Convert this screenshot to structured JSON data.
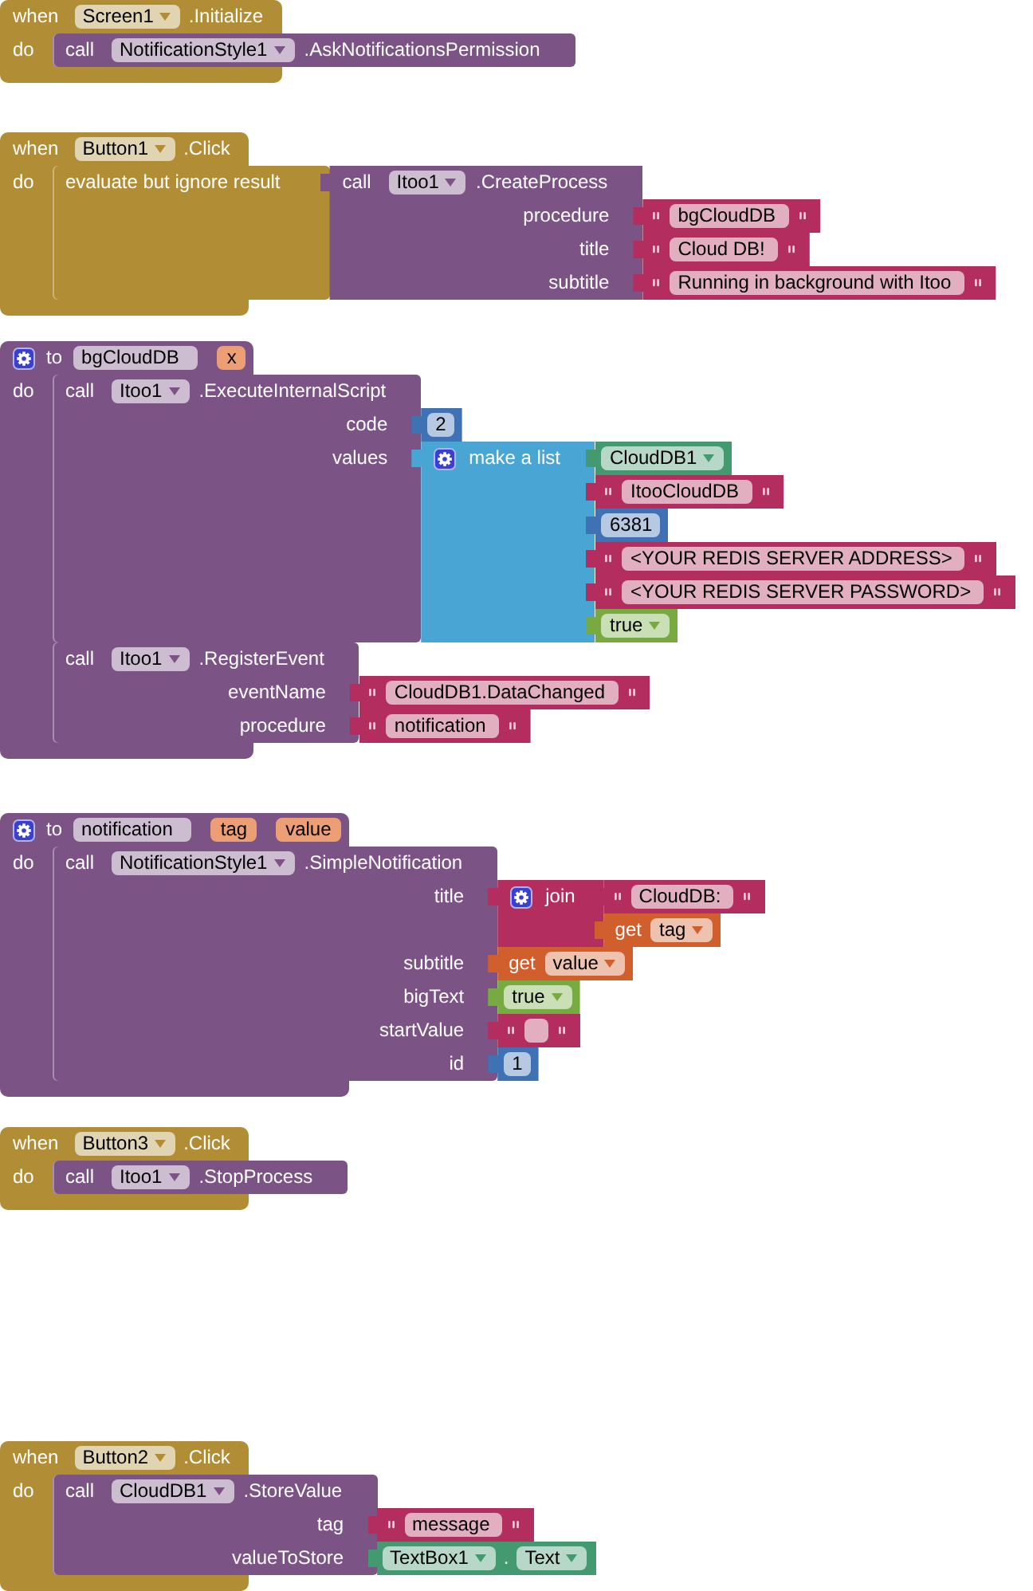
{
  "blocks": [
    {
      "kind": "event",
      "keyword": "when",
      "component": "Screen1",
      "event": ".Initialize",
      "do_label": "do",
      "body": [
        {
          "kind": "call",
          "keyword": "call",
          "component": "NotificationStyle1",
          "method": ".AskNotificationsPermission"
        }
      ]
    },
    {
      "kind": "event",
      "keyword": "when",
      "component": "Button1",
      "event": ".Click",
      "do_label": "do",
      "body": [
        {
          "kind": "evaluate",
          "text": "evaluate but ignore result",
          "inputs": [
            {
              "value": {
                "kind": "call",
                "keyword": "call",
                "component": "Itoo1",
                "method": ".CreateProcess",
                "inputs": [
                  {
                    "label": "procedure",
                    "value": {
                      "kind": "text",
                      "text": "bgCloudDB"
                    }
                  },
                  {
                    "label": "title",
                    "value": {
                      "kind": "text",
                      "text": "Cloud DB!"
                    }
                  },
                  {
                    "label": "subtitle",
                    "value": {
                      "kind": "text",
                      "text": "Running in background with Itoo"
                    }
                  }
                ]
              }
            }
          ]
        }
      ]
    },
    {
      "kind": "procedure",
      "keyword": "to",
      "name": "bgCloudDB",
      "params": [
        "x"
      ],
      "do_label": "do",
      "body": [
        {
          "kind": "call",
          "keyword": "call",
          "component": "Itoo1",
          "method": ".ExecuteInternalScript",
          "inputs": [
            {
              "label": "code",
              "value": {
                "kind": "number",
                "text": "2"
              }
            },
            {
              "label": "values",
              "value": {
                "kind": "make_list",
                "text": "make a list",
                "inputs": [
                  {
                    "value": {
                      "kind": "component",
                      "component": "CloudDB1"
                    }
                  },
                  {
                    "value": {
                      "kind": "text",
                      "text": "ItooCloudDB"
                    }
                  },
                  {
                    "value": {
                      "kind": "number",
                      "text": "6381"
                    }
                  },
                  {
                    "value": {
                      "kind": "text",
                      "text": "<YOUR REDIS SERVER ADDRESS>"
                    }
                  },
                  {
                    "value": {
                      "kind": "text",
                      "text": "<YOUR REDIS SERVER PASSWORD>"
                    }
                  },
                  {
                    "value": {
                      "kind": "boolean",
                      "text": "true"
                    }
                  }
                ]
              }
            }
          ]
        },
        {
          "kind": "call",
          "keyword": "call",
          "component": "Itoo1",
          "method": ".RegisterEvent",
          "inputs": [
            {
              "label": "eventName",
              "value": {
                "kind": "text",
                "text": "CloudDB1.DataChanged"
              }
            },
            {
              "label": "procedure",
              "value": {
                "kind": "text",
                "text": "notification"
              }
            }
          ]
        }
      ]
    },
    {
      "kind": "procedure",
      "keyword": "to",
      "name": "notification",
      "params": [
        "tag",
        "value"
      ],
      "do_label": "do",
      "body": [
        {
          "kind": "call",
          "keyword": "call",
          "component": "NotificationStyle1",
          "method": ".SimpleNotification",
          "inputs": [
            {
              "label": "title",
              "value": {
                "kind": "join",
                "text": "join",
                "inputs": [
                  {
                    "value": {
                      "kind": "text",
                      "text": "CloudDB:"
                    }
                  },
                  {
                    "value": {
                      "kind": "get",
                      "keyword": "get",
                      "variable": "tag"
                    }
                  }
                ]
              }
            },
            {
              "label": "subtitle",
              "value": {
                "kind": "get",
                "keyword": "get",
                "variable": "value"
              }
            },
            {
              "label": "bigText",
              "value": {
                "kind": "boolean",
                "text": "true"
              }
            },
            {
              "label": "startValue",
              "value": {
                "kind": "text"
              }
            },
            {
              "label": "id",
              "value": {
                "kind": "number",
                "text": "1"
              }
            }
          ]
        }
      ]
    },
    {
      "kind": "event",
      "keyword": "when",
      "component": "Button3",
      "event": ".Click",
      "do_label": "do",
      "body": [
        {
          "kind": "call",
          "keyword": "call",
          "component": "Itoo1",
          "method": ".StopProcess"
        }
      ]
    },
    {
      "kind": "event",
      "keyword": "when",
      "component": "Button2",
      "event": ".Click",
      "do_label": "do",
      "body": [
        {
          "kind": "call",
          "keyword": "call",
          "component": "CloudDB1",
          "method": ".StoreValue",
          "inputs": [
            {
              "label": "tag",
              "value": {
                "kind": "text",
                "text": "message"
              }
            },
            {
              "label": "valueToStore",
              "value": {
                "kind": "property",
                "component": "TextBox1",
                "separator": ".",
                "property": "Text"
              }
            }
          ]
        }
      ]
    }
  ]
}
